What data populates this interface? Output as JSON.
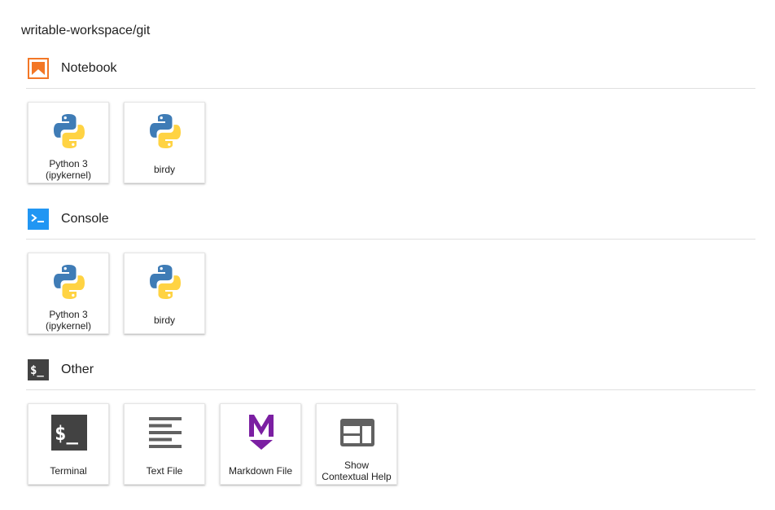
{
  "path": "writable-workspace/git",
  "sections": [
    {
      "label": "Notebook",
      "icon": "notebook-icon",
      "cards": [
        {
          "line1": "Python 3",
          "line2": "(ipykernel)",
          "icon": "python-icon"
        },
        {
          "line1": "birdy",
          "line2": "",
          "icon": "python-icon"
        }
      ]
    },
    {
      "label": "Console",
      "icon": "console-icon",
      "cards": [
        {
          "line1": "Python 3",
          "line2": "(ipykernel)",
          "icon": "python-icon"
        },
        {
          "line1": "birdy",
          "line2": "",
          "icon": "python-icon"
        }
      ]
    },
    {
      "label": "Other",
      "icon": "terminal-small-icon",
      "cards": [
        {
          "line1": "Terminal",
          "line2": "",
          "icon": "terminal-icon"
        },
        {
          "line1": "Text File",
          "line2": "",
          "icon": "text-file-icon"
        },
        {
          "line1": "Markdown File",
          "line2": "",
          "icon": "markdown-icon"
        },
        {
          "line1": "Show",
          "line2": "Contextual Help",
          "icon": "contextual-help-icon"
        }
      ]
    }
  ],
  "colors": {
    "notebook_orange": "#f37726",
    "console_blue": "#2196f3",
    "terminal_dark": "#424242",
    "markdown_purple": "#7b1fa2",
    "python_blue": "#3f7cb6",
    "python_yellow": "#ffd343"
  }
}
